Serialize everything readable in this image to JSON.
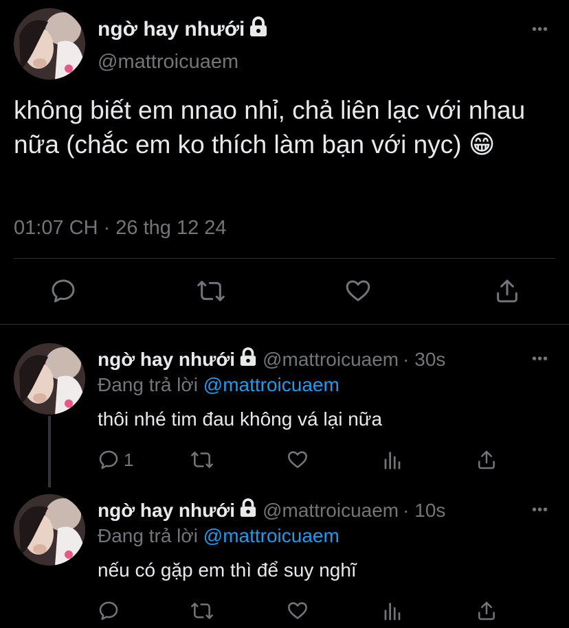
{
  "main_tweet": {
    "name": "ngờ hay nhưới",
    "handle": "@mattroicuaem",
    "text": "không biết em nnao nhỉ, chả liên lạc với nhau nữa (chắc em ko thích làm bạn với nyc)",
    "emoji": "😁",
    "timestamp": "01:07 CH · 26 thg 12 24",
    "more_label": "•••"
  },
  "replies": [
    {
      "name": "ngờ hay nhưới",
      "handle": "@mattroicuaem",
      "time": "· 30s",
      "replying_prefix": "Đang trả lời",
      "replying_to": "@mattroicuaem",
      "text": "thôi nhé tim đau không vá lại nữa",
      "reply_count": "1",
      "more_label": "•••"
    },
    {
      "name": "ngờ hay nhưới",
      "handle": "@mattroicuaem",
      "time": "· 10s",
      "replying_prefix": "Đang trả lời",
      "replying_to": "@mattroicuaem",
      "text": "nếu có gặp em thì để suy nghĩ",
      "reply_count": "",
      "more_label": "•••"
    }
  ],
  "icons": [
    "reply-icon",
    "retweet-icon",
    "like-icon",
    "share-icon",
    "views-icon",
    "lock-icon",
    "more-icon"
  ],
  "colors": {
    "background": "#000000",
    "text": "#e7e9ea",
    "muted": "#71767b",
    "link": "#1d9bf0",
    "divider": "#2f3336"
  }
}
